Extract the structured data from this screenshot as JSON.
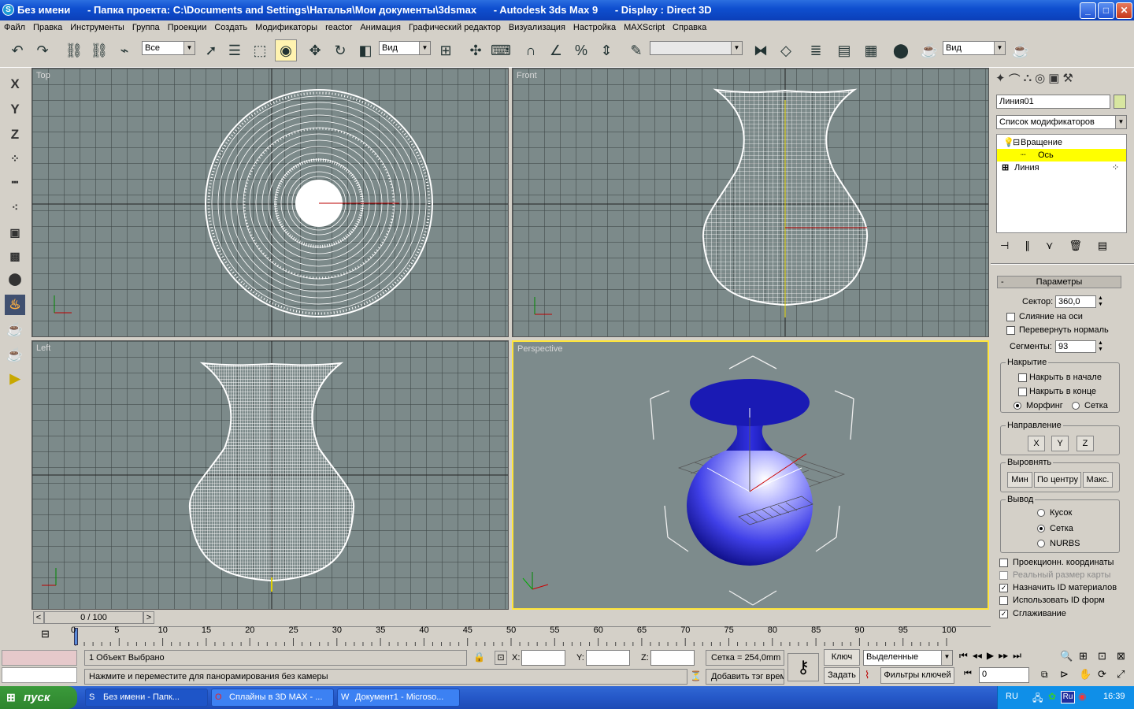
{
  "title": {
    "text": "Без имени      - Папка проекта: C:\\Documents and Settings\\Наталья\\Мои документы\\3dsmax      - Autodesk 3ds Max 9      - Display : Direct 3D",
    "icon": "3dsmax-app-icon"
  },
  "window_buttons": {
    "minimize": "_",
    "maximize": "□",
    "close": "✕"
  },
  "menu": [
    "Файл",
    "Правка",
    "Инструменты",
    "Группа",
    "Проекции",
    "Создать",
    "Модификаторы",
    "reactor",
    "Анимация",
    "Графический редактор",
    "Визуализация",
    "Настройка",
    "MAXScript",
    "Справка"
  ],
  "toolbar": {
    "selection_filter": "Все",
    "ref_coord": "Вид",
    "render_type": "Вид",
    "named_selection": ""
  },
  "left_toolbar": [
    "X",
    "Y",
    "Z"
  ],
  "viewports": {
    "top": {
      "label": "Top"
    },
    "front": {
      "label": "Front"
    },
    "left": {
      "label": "Left"
    },
    "perspective": {
      "label": "Perspective"
    }
  },
  "command_panel": {
    "object_name": "Линия01",
    "object_color": "#d8e6a0",
    "modifier_list": "Список модификаторов",
    "stack": [
      {
        "label": "Вращение",
        "state": "expanded"
      },
      {
        "label": "Ось",
        "state": "selected"
      },
      {
        "label": "Линия",
        "state": "collapsed"
      }
    ],
    "rollout_title": "Параметры",
    "degrees_label": "Сектор:",
    "degrees_value": "360,0",
    "weld_core": "Слияние на оси",
    "flip_normals": "Перевернуть нормаль",
    "segments_label": "Сегменты:",
    "segments_value": "93",
    "capping": {
      "title": "Накрытие",
      "cap_start": "Накрыть в начале",
      "cap_end": "Накрыть в конце",
      "morph": "Морфинг",
      "grid": "Сетка"
    },
    "direction": {
      "title": "Направление",
      "x": "X",
      "y": "Y",
      "z": "Z"
    },
    "align": {
      "title": "Выровнять",
      "min": "Мин",
      "center": "По центру",
      "max": "Макс."
    },
    "output": {
      "title": "Вывод",
      "patch": "Кусок",
      "mesh": "Сетка",
      "nurbs": "NURBS"
    },
    "gen_mapping": "Проекционн. координаты",
    "real_world": "Реальный размер карты",
    "gen_mat_ids": "Назначить ID материалов",
    "use_shape_ids": "Использовать ID форм",
    "smooth": "Сглаживание"
  },
  "timeline": {
    "slider": "0 / 100",
    "ticks": [
      "0",
      "5",
      "10",
      "15",
      "20",
      "25",
      "30",
      "35",
      "40",
      "45",
      "50",
      "55",
      "60",
      "65",
      "70",
      "75",
      "80",
      "85",
      "90",
      "95",
      "100"
    ]
  },
  "status": {
    "selected": "1 Объект Выбрано",
    "prompt": "Нажмите и переместите для панорамирования без камеры",
    "x_label": "X:",
    "y_label": "Y:",
    "z_label": "Z:",
    "grid": "Сетка = 254,0mm",
    "add_time_tag": "Добавить тэг врем",
    "key_label": "Ключ",
    "set_label": "Задать",
    "key_mode": "Выделенные",
    "key_filters": "Фильтры ключей",
    "frame": "0"
  },
  "taskbar": {
    "start": "пуск",
    "tasks": [
      "Без имени      - Папк...",
      "Сплайны в 3D MAX - ...",
      "Документ1 - Microso..."
    ],
    "lang": "RU",
    "lang_badge": "Ru",
    "clock": "16:39"
  }
}
